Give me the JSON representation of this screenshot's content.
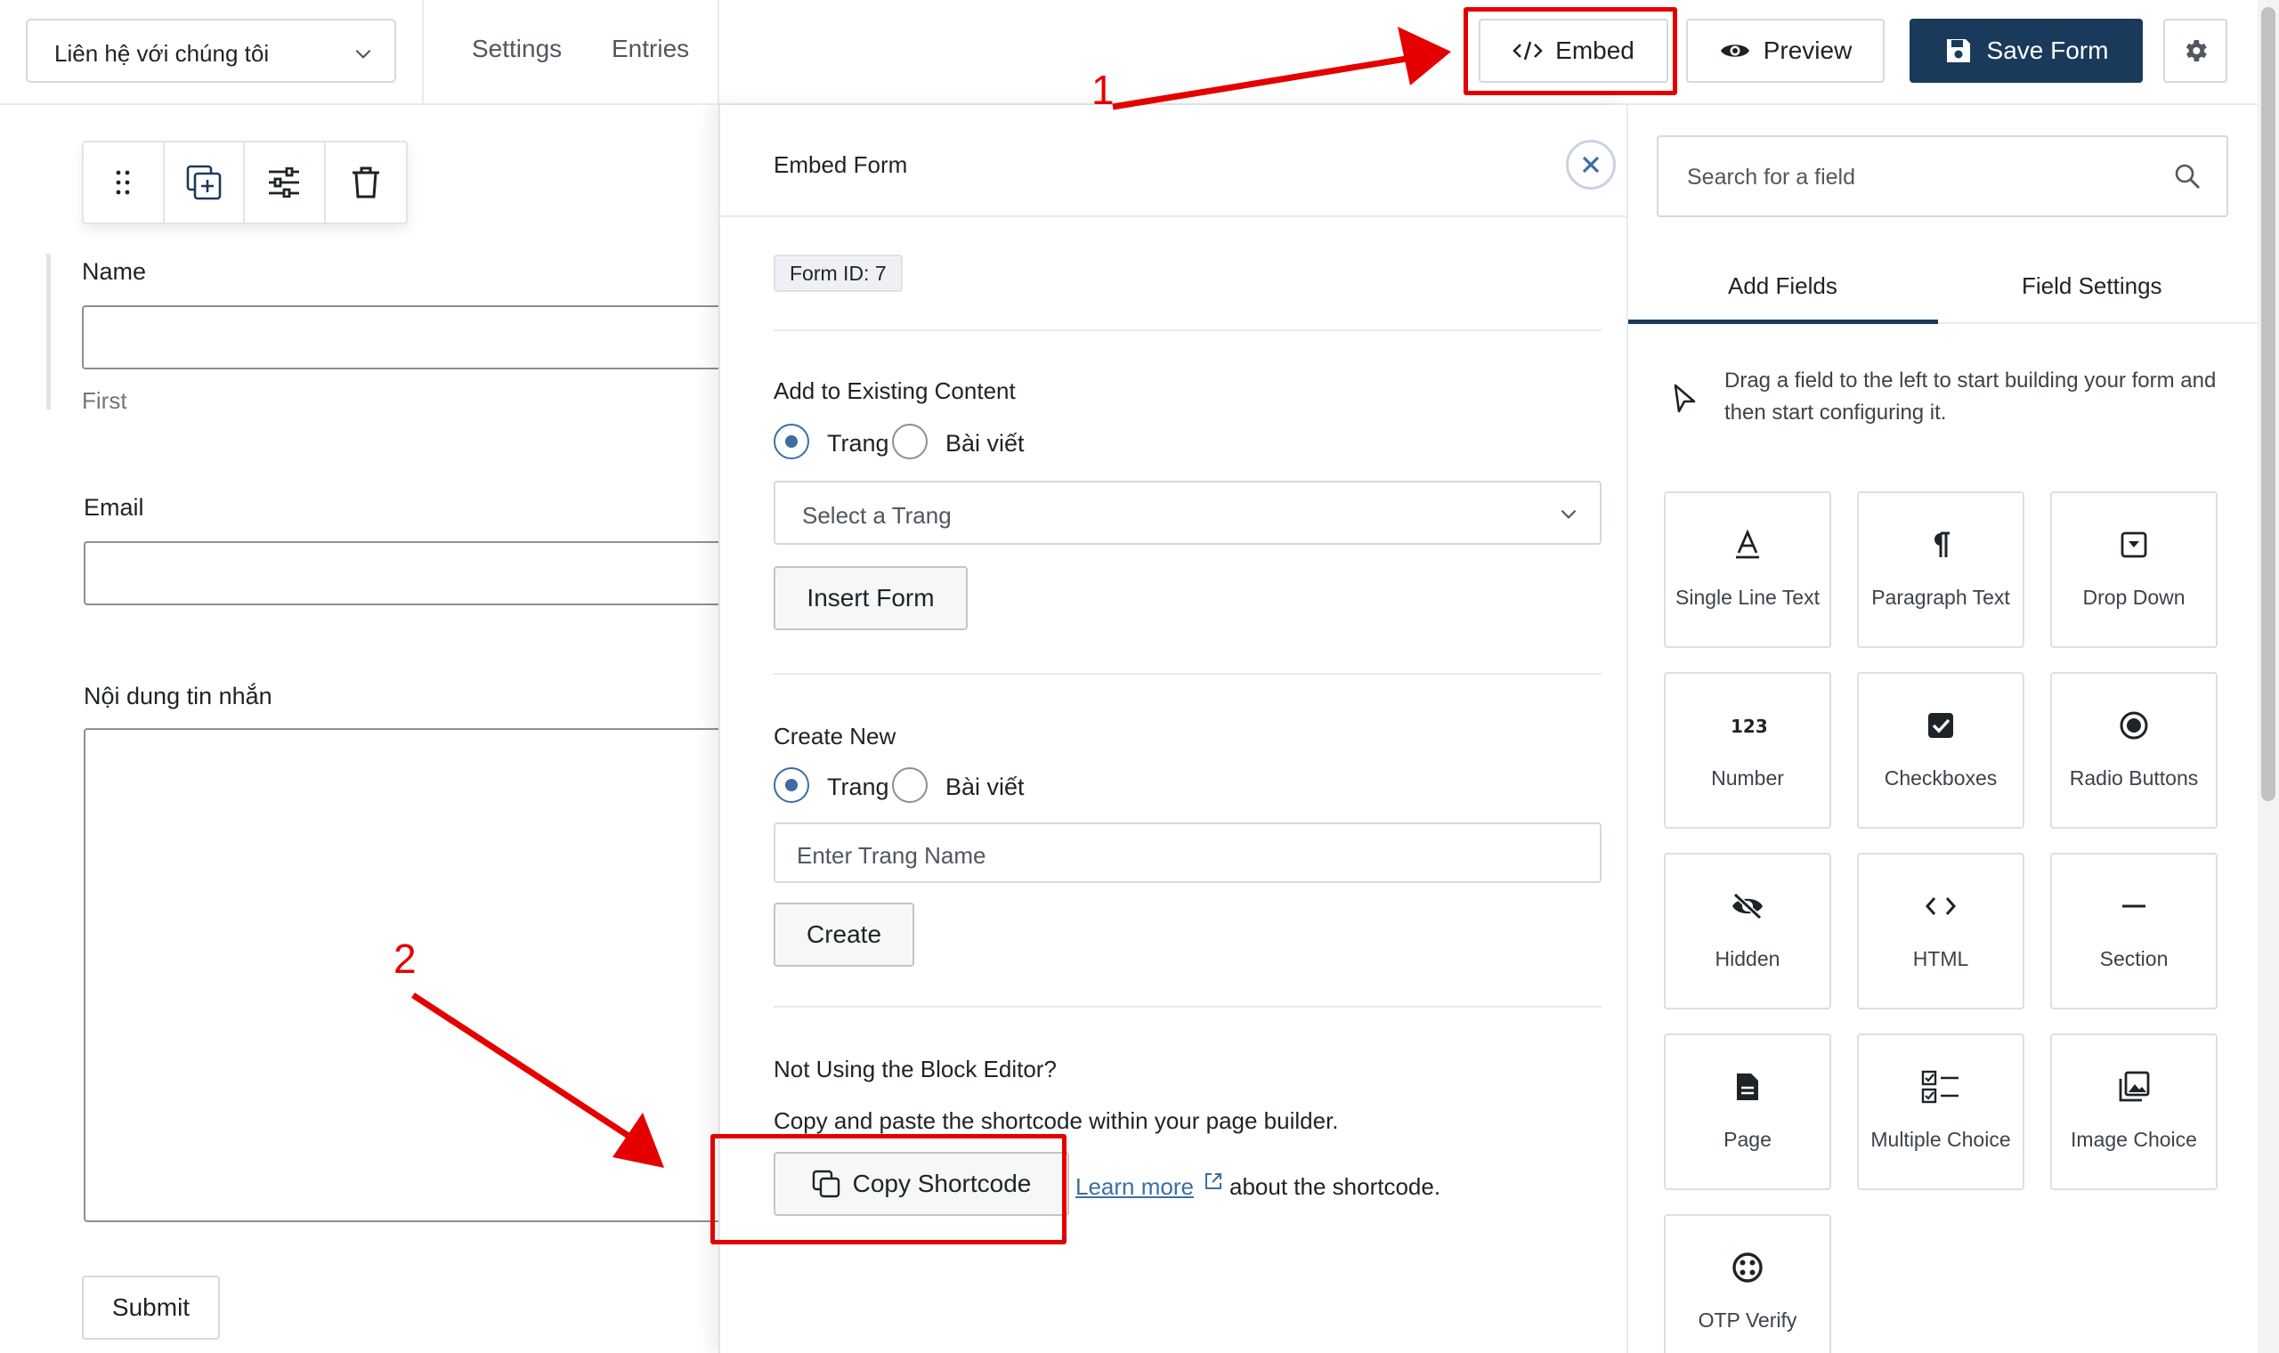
{
  "header": {
    "form_selector": "Liên hệ với chúng tôi",
    "nav": [
      "Settings",
      "Entries"
    ],
    "embed_label": "Embed",
    "preview_label": "Preview",
    "save_label": "Save Form"
  },
  "form": {
    "fields": [
      {
        "label": "Name",
        "sub_label": "First"
      },
      {
        "label": "Email"
      },
      {
        "label": "Nội dung tin nhắn"
      }
    ],
    "submit_label": "Submit"
  },
  "embed_panel": {
    "title": "Embed Form",
    "form_id": "Form ID: 7",
    "existing": {
      "heading": "Add to Existing Content",
      "option_page": "Trang",
      "option_post": "Bài viết",
      "select_placeholder": "Select a Trang",
      "button": "Insert Form"
    },
    "create_new": {
      "heading": "Create New",
      "option_page": "Trang",
      "option_post": "Bài viết",
      "input_placeholder": "Enter Trang Name",
      "button": "Create"
    },
    "shortcode": {
      "heading": "Not Using the Block Editor?",
      "description": "Copy and paste the shortcode within your page builder.",
      "button": "Copy Shortcode",
      "learn_more": "Learn more",
      "suffix": "about the shortcode."
    }
  },
  "sidebar": {
    "search_placeholder": "Search for a field",
    "tabs": [
      "Add Fields",
      "Field Settings"
    ],
    "hint": "Drag a field to the left to start building your form and then start configuring it.",
    "fields": [
      {
        "label": "Single Line Text",
        "icon": "text-icon"
      },
      {
        "label": "Paragraph Text",
        "icon": "pilcrow-icon"
      },
      {
        "label": "Drop Down",
        "icon": "dropdown-icon"
      },
      {
        "label": "Number",
        "icon": "number-icon"
      },
      {
        "label": "Checkboxes",
        "icon": "checkbox-icon"
      },
      {
        "label": "Radio Buttons",
        "icon": "radio-icon"
      },
      {
        "label": "Hidden",
        "icon": "eye-off-icon"
      },
      {
        "label": "HTML",
        "icon": "code-icon"
      },
      {
        "label": "Section",
        "icon": "minus-icon"
      },
      {
        "label": "Page",
        "icon": "page-icon"
      },
      {
        "label": "Multiple Choice",
        "icon": "multiple-choice-icon"
      },
      {
        "label": "Image Choice",
        "icon": "image-choice-icon"
      },
      {
        "label": "OTP Verify",
        "icon": "otp-icon"
      }
    ]
  },
  "annotations": {
    "step1": "1",
    "step2": "2",
    "color": "#e50000"
  },
  "colors": {
    "primary": "#1a3a5c",
    "radio_active": "#3e6da2",
    "tab_active": "#1a3a5c"
  }
}
